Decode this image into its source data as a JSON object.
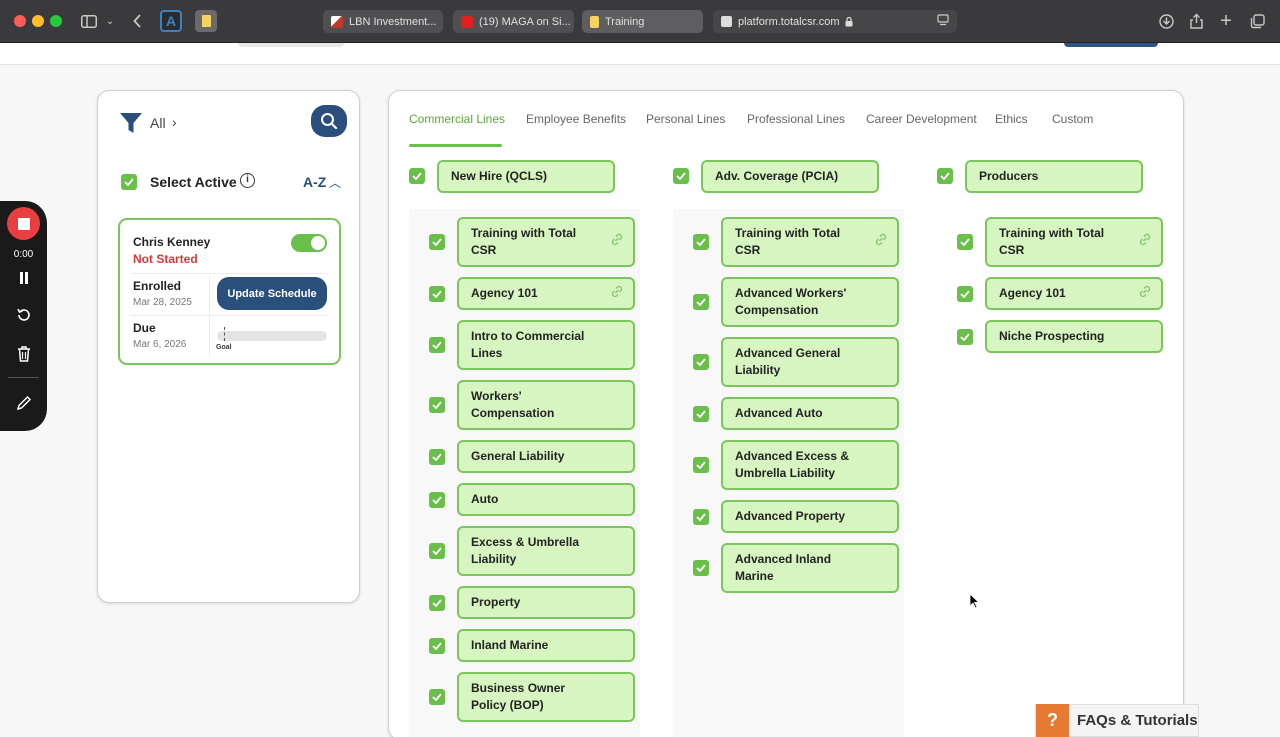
{
  "browser": {
    "tabs": [
      {
        "label": "LBN Investment..."
      },
      {
        "label": "(19) MAGA on Si..."
      },
      {
        "label": "Training"
      }
    ],
    "url": "platform.totalcsr.com"
  },
  "filter": {
    "label": "All"
  },
  "select_active": {
    "label": "Select Active",
    "sort_label": "A-Z"
  },
  "employee": {
    "name": "Chris Kenney",
    "status": "Not Started",
    "enrolled_label": "Enrolled",
    "enrolled_date": "Mar 28, 2025",
    "update_button": "Update Schedule",
    "due_label": "Due",
    "due_date": "Mar 6, 2026",
    "goal_label": "Goal",
    "active": true
  },
  "recorder": {
    "time": "0:00"
  },
  "category_tabs": [
    {
      "label": "Commercial Lines",
      "active": true
    },
    {
      "label": "Employee Benefits"
    },
    {
      "label": "Personal Lines"
    },
    {
      "label": "Professional Lines"
    },
    {
      "label": "Career Development"
    },
    {
      "label": "Ethics"
    },
    {
      "label": "Custom"
    }
  ],
  "columns": [
    {
      "title": "New Hire (QCLS)",
      "courses": [
        {
          "label": "Training with Total CSR",
          "linked": true
        },
        {
          "label": "Agency 101",
          "linked": true
        },
        {
          "label": "Intro to Commercial Lines"
        },
        {
          "label": "Workers' Compensation"
        },
        {
          "label": "General Liability"
        },
        {
          "label": "Auto"
        },
        {
          "label": "Excess & Umbrella Liability"
        },
        {
          "label": "Property"
        },
        {
          "label": "Inland Marine"
        },
        {
          "label": "Business Owner Policy (BOP)"
        }
      ]
    },
    {
      "title": "Adv. Coverage (PCIA)",
      "courses": [
        {
          "label": "Training with Total CSR",
          "linked": true
        },
        {
          "label": "Advanced Workers' Compensation"
        },
        {
          "label": "Advanced General Liability"
        },
        {
          "label": "Advanced Auto"
        },
        {
          "label": "Advanced Excess & Umbrella Liability"
        },
        {
          "label": "Advanced Property"
        },
        {
          "label": "Advanced Inland Marine"
        }
      ]
    },
    {
      "title": "Producers",
      "courses": [
        {
          "label": "Training with Total CSR",
          "linked": true
        },
        {
          "label": "Agency 101",
          "linked": true
        },
        {
          "label": "Niche Prospecting"
        }
      ]
    }
  ],
  "faq": {
    "label": "FAQs & Tutorials",
    "icon": "?"
  },
  "colors": {
    "accent_green": "#6abf4b",
    "card_fill": "#d7f5c0",
    "primary_blue": "#2a4f7c",
    "status_red": "#d23a3a",
    "faq_orange": "#e67a32"
  }
}
